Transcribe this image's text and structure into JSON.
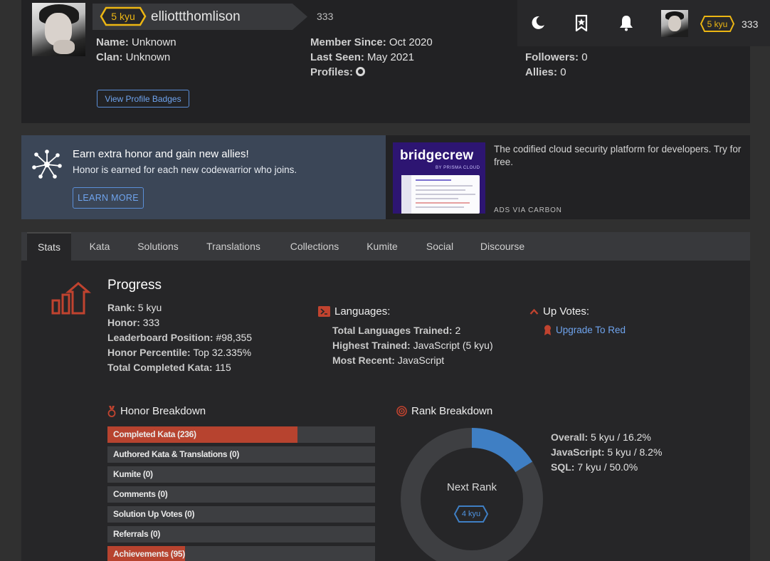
{
  "profile": {
    "rank": "5 kyu",
    "username": "elliottthomlison",
    "honor": "333",
    "left_info": [
      {
        "label": "Name:",
        "value": "Unknown"
      },
      {
        "label": "Clan:",
        "value": "Unknown"
      }
    ],
    "mid_info": [
      {
        "label": "Member Since:",
        "value": "Oct 2020"
      },
      {
        "label": "Last Seen:",
        "value": "May 2021"
      },
      {
        "label": "Profiles:",
        "value": ""
      }
    ],
    "right_info": [
      {
        "label": "Followers:",
        "value": "0"
      },
      {
        "label": "Allies:",
        "value": "0"
      }
    ],
    "badges_button": "View Profile Badges"
  },
  "toolbar": {
    "rank": "5 kyu",
    "honor": "333",
    "icons": [
      "moon-icon",
      "bookmark-star-icon",
      "bell-icon"
    ]
  },
  "promo": {
    "title": "Earn extra honor and gain new allies!",
    "subtitle": "Honor is earned for each new codewarrior who joins.",
    "button": "LEARN MORE"
  },
  "ad": {
    "logo": "bridgecrew",
    "logo_by": "BY PRISMA CLOUD",
    "text": "The codified cloud security platform for developers. Try for free.",
    "via": "ADS VIA CARBON"
  },
  "tabs": [
    "Stats",
    "Kata",
    "Solutions",
    "Translations",
    "Collections",
    "Kumite",
    "Social",
    "Discourse"
  ],
  "progress": {
    "title": "Progress",
    "stats": [
      {
        "label": "Rank:",
        "value": "5 kyu"
      },
      {
        "label": "Honor:",
        "value": "333"
      },
      {
        "label": "Leaderboard Position:",
        "value": "#98,355"
      },
      {
        "label": "Honor Percentile:",
        "value": "Top 32.335%"
      },
      {
        "label": "Total Completed Kata:",
        "value": "115"
      }
    ]
  },
  "languages": {
    "title": "Languages:",
    "stats": [
      {
        "label": "Total Languages Trained:",
        "value": "2"
      },
      {
        "label": "Highest Trained:",
        "value": "JavaScript (5 kyu)"
      },
      {
        "label": "Most Recent:",
        "value": "JavaScript"
      }
    ]
  },
  "upvotes": {
    "title": "Up Votes:",
    "link": "Upgrade To Red"
  },
  "honor_breakdown": {
    "title": "Honor Breakdown",
    "items": [
      {
        "label": "Completed Kata (236)",
        "fill": 0.71
      },
      {
        "label": "Authored Kata & Translations (0)",
        "fill": 0
      },
      {
        "label": "Kumite (0)",
        "fill": 0
      },
      {
        "label": "Comments (0)",
        "fill": 0
      },
      {
        "label": "Solution Up Votes (0)",
        "fill": 0
      },
      {
        "label": "Referrals (0)",
        "fill": 0
      },
      {
        "label": "Achievements (95)",
        "fill": 0.29
      }
    ]
  },
  "rank_breakdown": {
    "title": "Rank Breakdown",
    "center_label": "Next Rank",
    "next_rank": "4 kyu",
    "progress": 0.162,
    "stats": [
      {
        "label": "Overall:",
        "value": "5 kyu / 16.2%"
      },
      {
        "label": "JavaScript:",
        "value": "5 kyu / 8.2%"
      },
      {
        "label": "SQL:",
        "value": "7 kyu / 50.0%"
      }
    ]
  },
  "colors": {
    "accent_red": "#b7432f",
    "rank_yellow": "#ecb613",
    "link_blue": "#6fa4ee",
    "progress_blue": "#3f7fc4"
  }
}
